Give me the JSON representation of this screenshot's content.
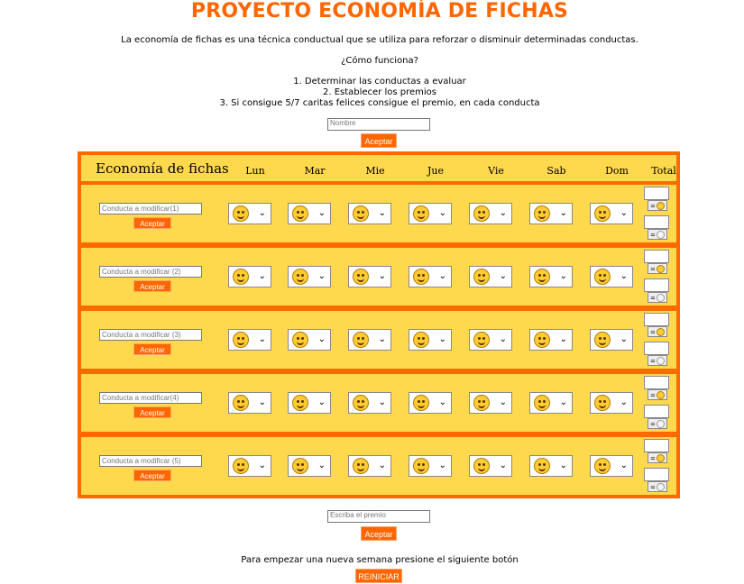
{
  "page": {
    "title": "PROYECTO ECONOMÍA DE FICHAS",
    "intro": "La economía de fichas es una técnica conductual que se utiliza para reforzar o disminuir determinadas conductas.",
    "question": "¿Cómo funciona?",
    "steps": [
      "1. Determinar las conductas a evaluar",
      "2. Establecer los premios",
      "3. Si consigue 5/7 caritas felices consigue el premio, en cada conducta"
    ]
  },
  "name_form": {
    "placeholder": "Nombre",
    "button": "Aceptar"
  },
  "board": {
    "title": "Economía de fichas",
    "days": [
      "Lun",
      "Mar",
      "Mie",
      "Jue",
      "Vie",
      "Sab",
      "Dom"
    ],
    "total_label": "Total",
    "rows": [
      {
        "placeholder": "Conducta a modificar(1)",
        "button": "Aceptar"
      },
      {
        "placeholder": "Conducta a modificar (2)",
        "button": "Aceptar"
      },
      {
        "placeholder": "Conducta a modificar (3)",
        "button": "Aceptar"
      },
      {
        "placeholder": "Conducta a modificar(4)",
        "button": "Aceptar"
      },
      {
        "placeholder": "Conducta a modificar (5)",
        "button": "Aceptar"
      }
    ],
    "select_value_icon": "smiley-face-icon",
    "total_happy_label": "=",
    "total_sad_label": "="
  },
  "prize_form": {
    "placeholder": "Escriba el premio",
    "button": "Aceptar"
  },
  "reset": {
    "text": "Para empezar una nueva semana presione el siguiente botón",
    "button": "REINICIAR"
  },
  "colors": {
    "accent": "#ff6600",
    "board_bg": "#ffd94d",
    "border": "#ff6a00"
  }
}
